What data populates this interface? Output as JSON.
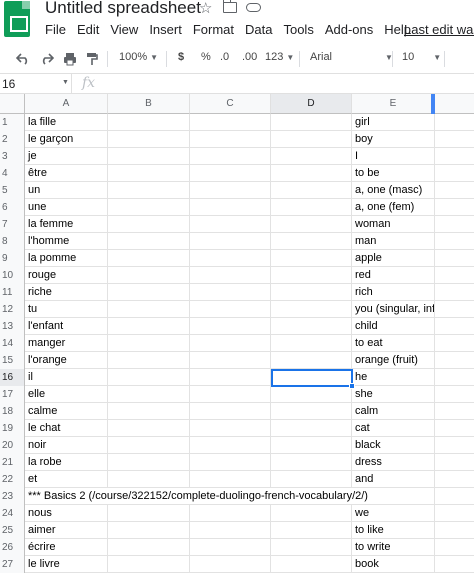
{
  "document": {
    "title": "Untitled spreadsheet",
    "last_edit": "Last edit was"
  },
  "menu": [
    "File",
    "Edit",
    "View",
    "Insert",
    "Format",
    "Data",
    "Tools",
    "Add-ons",
    "Help"
  ],
  "toolbar": {
    "undo_icon": "undo-icon",
    "redo_icon": "redo-icon",
    "print_icon": "print-icon",
    "paint_format_icon": "paint-format-icon",
    "zoom": "100%",
    "currency": "$",
    "percent": "%",
    "decrease_decimal": ".0",
    "increase_decimal": ".00",
    "more_formats": "123",
    "font": "Arial",
    "font_size": "10"
  },
  "formula_bar": {
    "cell_ref": "16",
    "fx": "fx"
  },
  "columns": [
    "A",
    "B",
    "C",
    "D",
    "E"
  ],
  "selected_column": "D",
  "selected_row": 16,
  "rows": [
    {
      "n": "1",
      "a": "la fille",
      "e": "girl"
    },
    {
      "n": "2",
      "a": "le garçon",
      "e": "boy"
    },
    {
      "n": "3",
      "a": "je",
      "e": "I"
    },
    {
      "n": "4",
      "a": "être",
      "e": "to be"
    },
    {
      "n": "5",
      "a": "un",
      "e": "a, one (masc)"
    },
    {
      "n": "6",
      "a": "une",
      "e": "a, one (fem)"
    },
    {
      "n": "7",
      "a": "la femme",
      "e": "woman"
    },
    {
      "n": "8",
      "a": "l'homme",
      "e": "man"
    },
    {
      "n": "9",
      "a": "la pomme",
      "e": "apple"
    },
    {
      "n": "10",
      "a": "rouge",
      "e": "red"
    },
    {
      "n": "11",
      "a": "riche",
      "e": "rich"
    },
    {
      "n": "12",
      "a": "tu",
      "e": "you (singular, inf"
    },
    {
      "n": "13",
      "a": "l'enfant",
      "e": "child"
    },
    {
      "n": "14",
      "a": "manger",
      "e": "to eat"
    },
    {
      "n": "15",
      "a": "l'orange",
      "e": "orange (fruit)"
    },
    {
      "n": "16",
      "a": "il",
      "e": "he"
    },
    {
      "n": "17",
      "a": "elle",
      "e": "she"
    },
    {
      "n": "18",
      "a": "calme",
      "e": "calm"
    },
    {
      "n": "19",
      "a": "le chat",
      "e": "cat"
    },
    {
      "n": "20",
      "a": "noir",
      "e": "black"
    },
    {
      "n": "21",
      "a": "la robe",
      "e": "dress"
    },
    {
      "n": "22",
      "a": "et",
      "e": "and"
    },
    {
      "n": "23",
      "a": "*** Basics 2 (/course/322152/complete-duolingo-french-vocabulary/2/)",
      "e": ""
    },
    {
      "n": "24",
      "a": "nous",
      "e": "we"
    },
    {
      "n": "25",
      "a": "aimer",
      "e": "to like"
    },
    {
      "n": "26",
      "a": "écrire",
      "e": "to write"
    },
    {
      "n": "27",
      "a": "le livre",
      "e": "book"
    }
  ]
}
